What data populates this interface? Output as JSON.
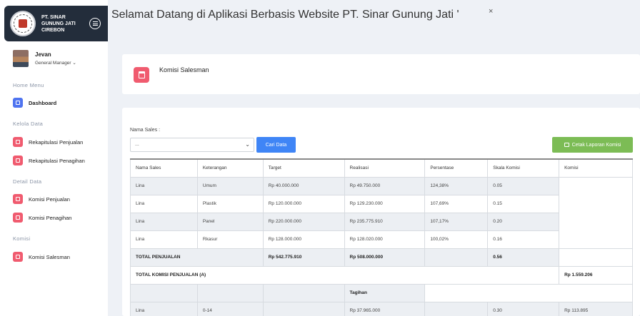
{
  "brand": {
    "line1": "PT. SINAR",
    "line2": "GUNUNG JATI",
    "line3": "CIREBON"
  },
  "user": {
    "name": "Jevan",
    "role": "General Manager ⌄"
  },
  "sidebar": {
    "home_label": "Home Menu",
    "dashboard": "Dashboard",
    "kelola_label": "Kelola Data",
    "rekap_penjualan": "Rekapitulasi Penjualan",
    "rekap_penagihan": "Rekapitulasi Penagihan",
    "detail_label": "Detail Data",
    "komisi_penjualan": "Komisi Penjualan",
    "komisi_penagihan": "Komisi Penagihan",
    "komisi_label": "Komisi",
    "komisi_salesman": "Komisi Salesman"
  },
  "header": {
    "title": "Selamat Datang di Aplikasi Berbasis Website PT. Sinar Gunung Jati '",
    "close": "×"
  },
  "page": {
    "title": "Komisi Salesman"
  },
  "filter": {
    "label": "Nama Sales :",
    "select_value": "...",
    "caret": "⌄",
    "search_button": "Cari Data",
    "print_button": "Cetak Laporan Komisi"
  },
  "table": {
    "headers": [
      "Nama Sales",
      "Keterangan",
      "Target",
      "Realisasi",
      "Persentase",
      "Skala Komisi",
      "Komisi"
    ],
    "rows": [
      [
        "Lina",
        "Umum",
        "Rp 40.000.000",
        "Rp 49.750.000",
        "124,38%",
        "0.05"
      ],
      [
        "Lina",
        "Plastik",
        "Rp 120.000.000",
        "Rp 129.230.000",
        "107,69%",
        "0.15"
      ],
      [
        "Lina",
        "Panel",
        "Rp 220.000.000",
        "Rp 235.775.910",
        "107,17%",
        "0.20"
      ],
      [
        "Lina",
        "Rkasur",
        "Rp 128.000.000",
        "Rp 128.020.000",
        "100,02%",
        "0.16"
      ]
    ],
    "total_penjualan": {
      "label": "TOTAL PENJUALAN",
      "target": "Rp 542.775.910",
      "realisasi": "Rp 508.000.000",
      "skala": "0.56"
    },
    "total_komisi": {
      "label": "TOTAL KOMISI PENJUALAN (A)",
      "value": "Rp 1.559.206"
    },
    "tagihan_header": "Tagihan",
    "tagihan_row": [
      "Lina",
      "0-14",
      "Rp 37.965.000",
      "0.30",
      "Rp 113.895"
    ]
  }
}
